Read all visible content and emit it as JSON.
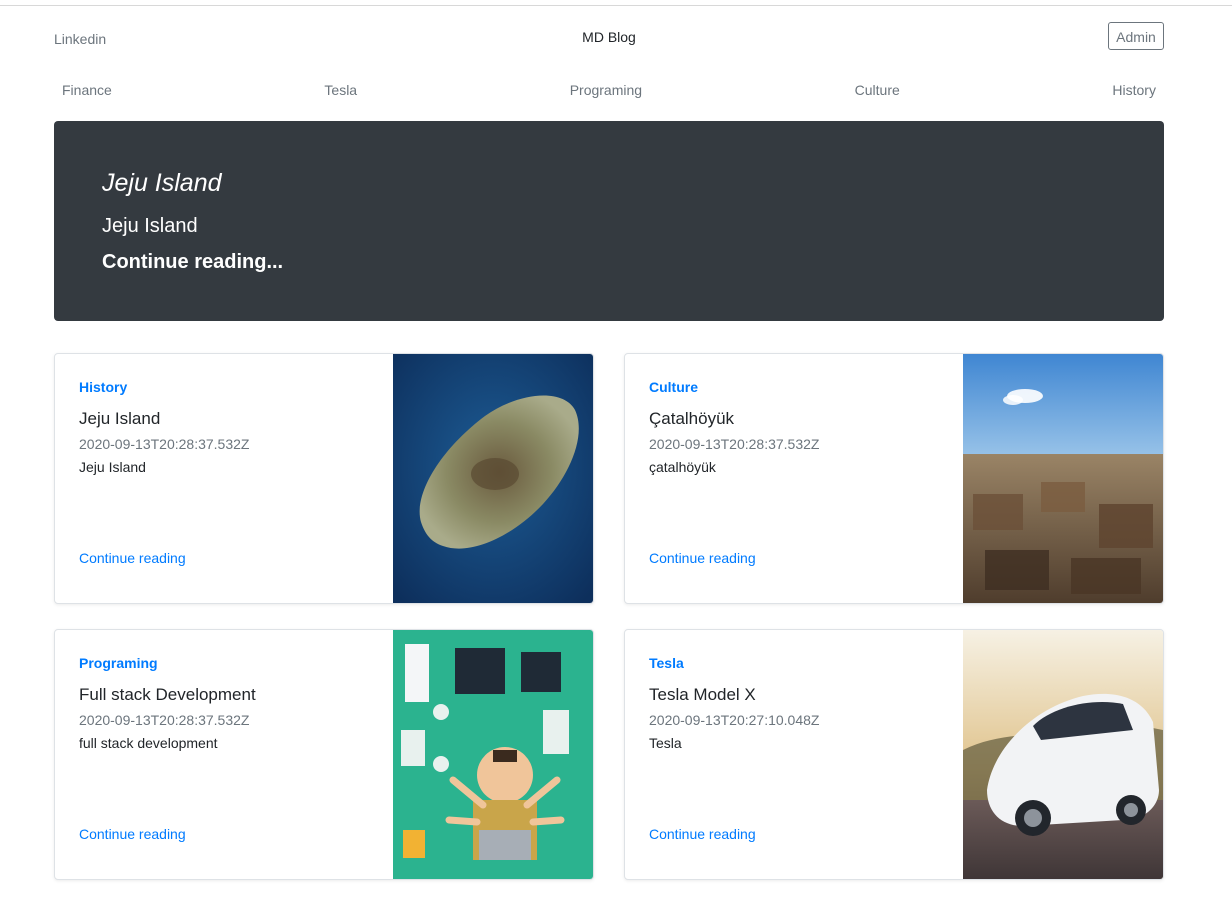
{
  "header": {
    "left_link": "Linkedin",
    "brand": "MD Blog",
    "admin_button": "Admin"
  },
  "nav": [
    "Finance",
    "Tesla",
    "Programing",
    "Culture",
    "History"
  ],
  "featured": {
    "title": "Jeju Island",
    "lead": "Jeju Island",
    "link": "Continue reading..."
  },
  "posts": [
    {
      "category": "History",
      "title": "Jeju Island",
      "date": "2020-09-13T20:28:37.532Z",
      "description": "Jeju Island",
      "link": "Continue reading",
      "image_icon": "island-satellite-image"
    },
    {
      "category": "Culture",
      "title": "Çatalhöyük",
      "date": "2020-09-13T20:28:37.532Z",
      "description": "çatalhöyük",
      "link": "Continue reading",
      "image_icon": "ruins-image"
    },
    {
      "category": "Programing",
      "title": "Full stack Development",
      "date": "2020-09-13T20:28:37.532Z",
      "description": "full stack development",
      "link": "Continue reading",
      "image_icon": "developer-illustration-image"
    },
    {
      "category": "Tesla",
      "title": "Tesla Model X",
      "date": "2020-09-13T20:27:10.048Z",
      "description": "Tesla",
      "link": "Continue reading",
      "image_icon": "car-image"
    }
  ],
  "colors": {
    "hero_bg": "#343a40",
    "accent": "#007bff",
    "muted": "#6c757d"
  }
}
